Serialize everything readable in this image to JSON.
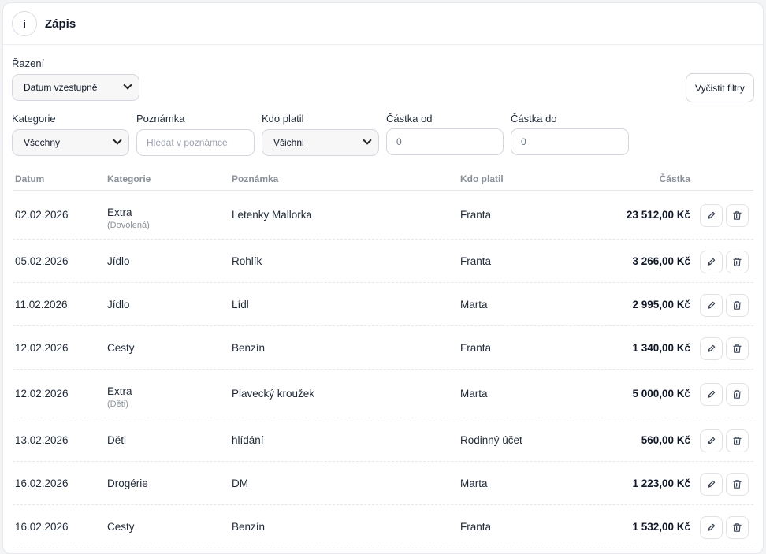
{
  "header": {
    "info_label": "i",
    "title": "Zápis"
  },
  "filters": {
    "sort_label": "Řazení",
    "sort_value": "Datum vzestupně",
    "clear_label": "Vyčistit filtry",
    "category_label": "Kategorie",
    "category_value": "Všechny",
    "note_label": "Poznámka",
    "note_placeholder": "Hledat v poznámce",
    "payer_label": "Kdo platil",
    "payer_value": "Všichni",
    "amount_from_label": "Částka od",
    "amount_from_value": "0",
    "amount_to_label": "Částka do",
    "amount_to_value": "0"
  },
  "table": {
    "columns": {
      "date": "Datum",
      "category": "Kategorie",
      "note": "Poznámka",
      "payer": "Kdo platil",
      "amount": "Částka"
    },
    "rows": [
      {
        "date": "02.02.2026",
        "category": "Extra",
        "subcategory": "(Dovolená)",
        "note": "Letenky Mallorka",
        "payer": "Franta",
        "amount": "23 512,00 Kč"
      },
      {
        "date": "05.02.2026",
        "category": "Jídlo",
        "subcategory": "",
        "note": "Rohlík",
        "payer": "Franta",
        "amount": "3 266,00 Kč"
      },
      {
        "date": "11.02.2026",
        "category": "Jídlo",
        "subcategory": "",
        "note": "Lídl",
        "payer": "Marta",
        "amount": "2 995,00 Kč"
      },
      {
        "date": "12.02.2026",
        "category": "Cesty",
        "subcategory": "",
        "note": "Benzín",
        "payer": "Franta",
        "amount": "1 340,00 Kč"
      },
      {
        "date": "12.02.2026",
        "category": "Extra",
        "subcategory": "(Děti)",
        "note": "Plavecký kroužek",
        "payer": "Marta",
        "amount": "5 000,00 Kč"
      },
      {
        "date": "13.02.2026",
        "category": "Děti",
        "subcategory": "",
        "note": "hlídání",
        "payer": "Rodinný účet",
        "amount": "560,00 Kč"
      },
      {
        "date": "16.02.2026",
        "category": "Drogérie",
        "subcategory": "",
        "note": "DM",
        "payer": "Marta",
        "amount": "1 223,00 Kč"
      },
      {
        "date": "16.02.2026",
        "category": "Cesty",
        "subcategory": "",
        "note": "Benzín",
        "payer": "Franta",
        "amount": "1 532,00 Kč"
      }
    ]
  },
  "icons": {
    "edit": "pencil-icon",
    "delete": "trash-icon",
    "dropdown": "chevron-down-icon"
  }
}
